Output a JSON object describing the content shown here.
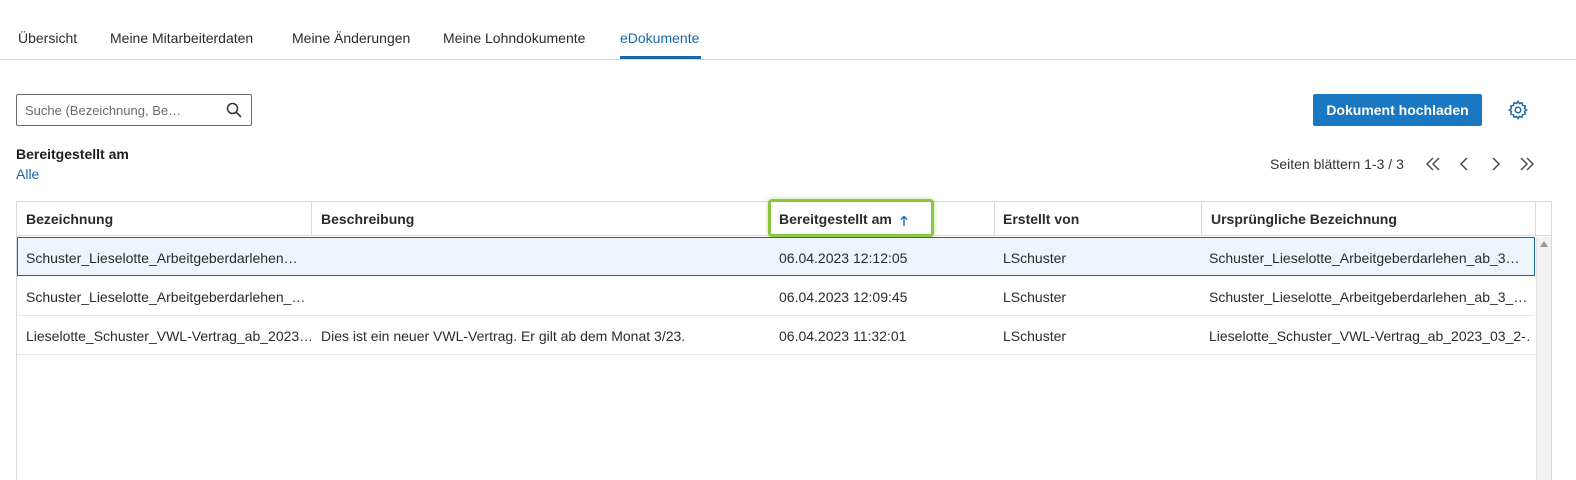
{
  "tabs": [
    {
      "label": "Übersicht",
      "active": false
    },
    {
      "label": "Meine Mitarbeiterdaten",
      "active": false
    },
    {
      "label": "Meine Änderungen",
      "active": false
    },
    {
      "label": "Meine Lohndokumente",
      "active": false
    },
    {
      "label": "eDokumente",
      "active": true
    }
  ],
  "search": {
    "placeholder": "Suche (Bezeichnung, Be…",
    "value": ""
  },
  "toolbar": {
    "upload_label": "Dokument hochladen"
  },
  "filter": {
    "label": "Bereitgestellt am",
    "value": "Alle"
  },
  "pagination": {
    "info": "Seiten blättern 1-3 / 3"
  },
  "table": {
    "columns": [
      "Bezeichnung",
      "Beschreibung",
      "Bereitgestellt am",
      "Erstellt von",
      "Ursprüngliche Bezeichnung"
    ],
    "sorted_column": "Bereitgestellt am",
    "sort_direction": "ascending",
    "rows": [
      {
        "bezeichnung": "Schuster_Lieselotte_Arbeitgeberdarlehen…",
        "beschreibung": "",
        "bereitgestellt": "06.04.2023 12:12:05",
        "erstellt_von": "LSchuster",
        "urspruenglich": "Schuster_Lieselotte_Arbeitgeberdarlehen_ab_3…",
        "selected": true
      },
      {
        "bezeichnung": "Schuster_Lieselotte_Arbeitgeberdarlehen_…",
        "beschreibung": "",
        "bereitgestellt": "06.04.2023 12:09:45",
        "erstellt_von": "LSchuster",
        "urspruenglich": "Schuster_Lieselotte_Arbeitgeberdarlehen_ab_3_…",
        "selected": false
      },
      {
        "bezeichnung": "Lieselotte_Schuster_VWL-Vertrag_ab_2023…",
        "beschreibung": "Dies ist ein neuer VWL-Vertrag. Er gilt ab dem Monat 3/23.",
        "bereitgestellt": "06.04.2023 11:32:01",
        "erstellt_von": "LSchuster",
        "urspruenglich": "Lieselotte_Schuster_VWL-Vertrag_ab_2023_03_2-…",
        "selected": false
      }
    ]
  },
  "colors": {
    "accent": "#1a66a8",
    "button": "#1a78c2",
    "highlight": "#8cc63f"
  },
  "icons": [
    "search-icon",
    "gear-icon",
    "first-page-icon",
    "prev-page-icon",
    "next-page-icon",
    "last-page-icon",
    "sort-ascending-icon",
    "scroll-up-icon"
  ]
}
